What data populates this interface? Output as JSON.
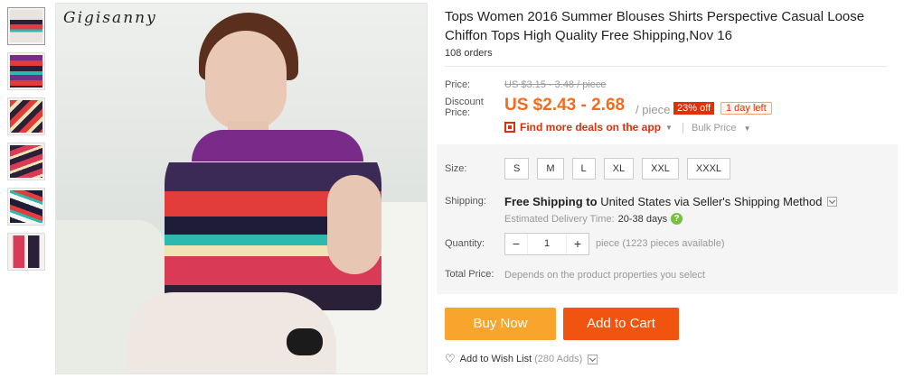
{
  "image": {
    "watermark": "Gigisanny"
  },
  "product": {
    "title": "Tops Women 2016 Summer Blouses Shirts Perspective Casual Loose Chiffon Tops High Quality Free Shipping,Nov 16",
    "orders": "108 orders"
  },
  "price": {
    "label": "Price:",
    "original": "US $3.15 - 3.48 / piece",
    "discount_label": "Discount Price:",
    "discount": "US $2.43 - 2.68",
    "per": "/ piece",
    "off_badge": "23% off",
    "time_left": "1 day left",
    "app_deals": "Find more deals on the app",
    "bulk": "Bulk Price"
  },
  "size": {
    "label": "Size:",
    "options": [
      "S",
      "M",
      "L",
      "XL",
      "XXL",
      "XXXL"
    ]
  },
  "shipping": {
    "label": "Shipping:",
    "text_prefix": "Free Shipping to",
    "text_dest": "United States via Seller's Shipping Method",
    "estimate_label": "Estimated Delivery Time:",
    "estimate_value": "20-38 days",
    "help_icon": "?"
  },
  "quantity": {
    "label": "Quantity:",
    "minus": "−",
    "value": "1",
    "plus": "+",
    "available": "piece (1223 pieces available)"
  },
  "total": {
    "label": "Total Price:",
    "value": "Depends on the product properties you select"
  },
  "actions": {
    "buy_now": "Buy Now",
    "add_to_cart": "Add to Cart",
    "wish_list": "Add to Wish List",
    "wish_count": "(280 Adds)"
  },
  "colors": {
    "accent": "#f46b1b",
    "badge_red": "#e62e04",
    "buy_now": "#f9a42c",
    "add_to_cart": "#f1540e"
  }
}
